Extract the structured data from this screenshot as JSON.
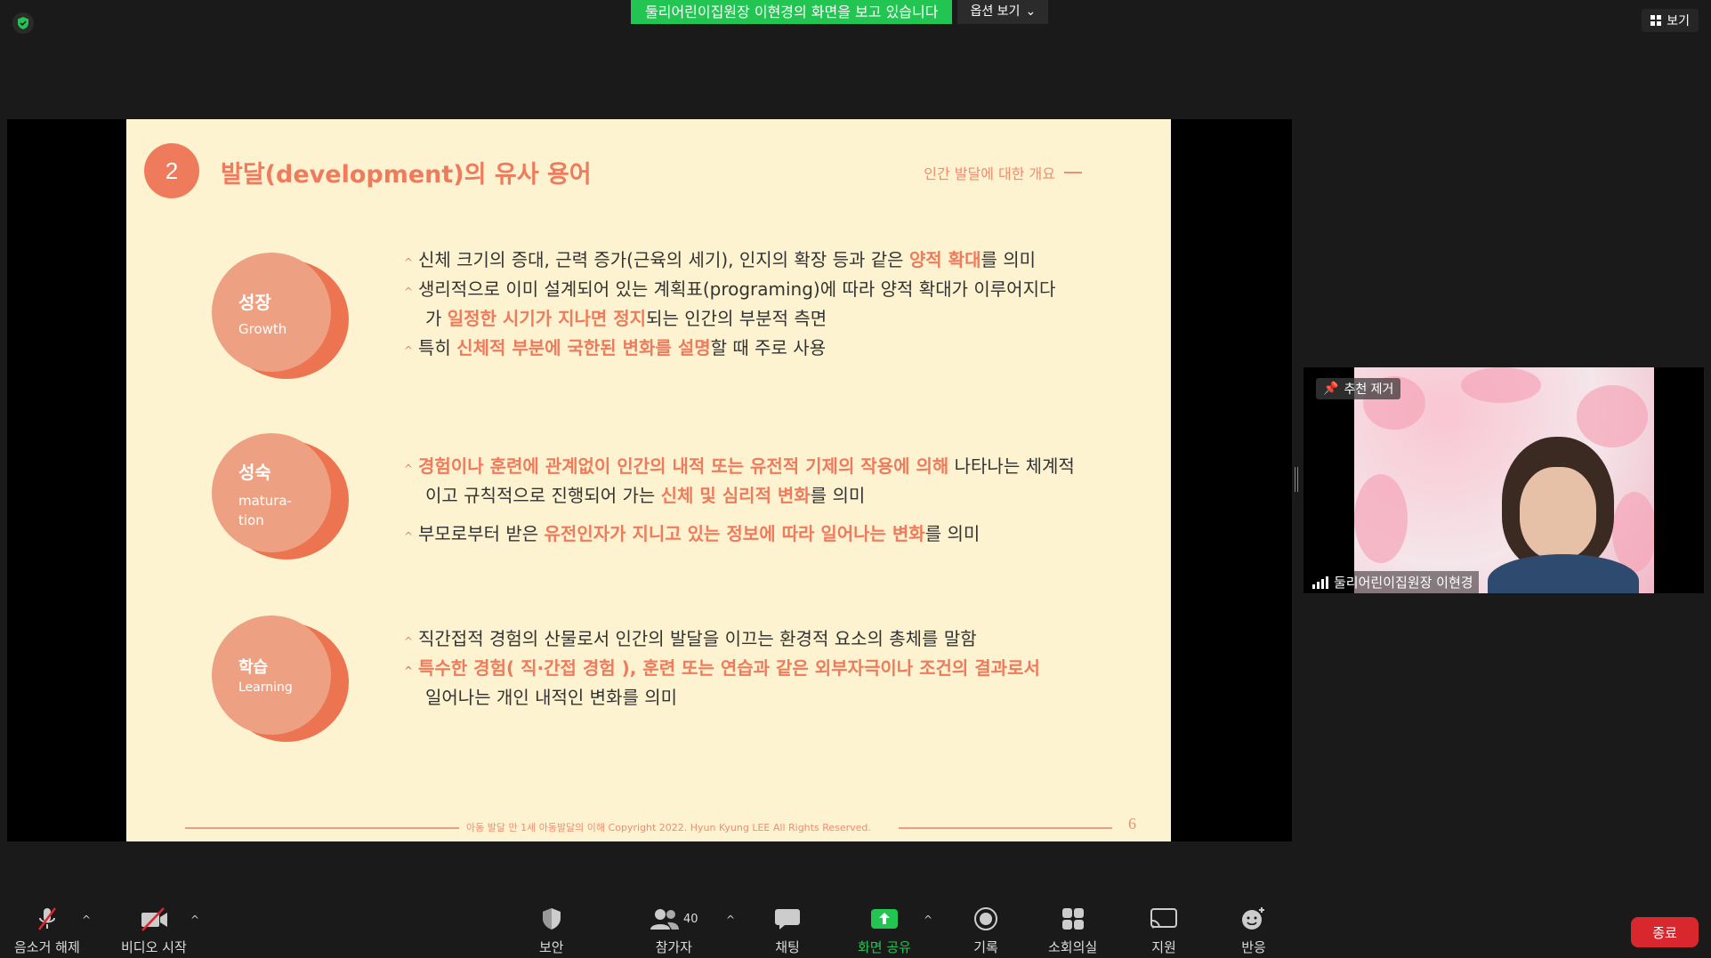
{
  "top": {
    "share_banner": "둘리어린이집원장 이현경의 화면을 보고 있습니다",
    "options_label": "옵션 보기",
    "view_label": "보기"
  },
  "slide": {
    "number": "2",
    "title": "발달(development)의 유사 용어",
    "subtitle": "인간 발달에 대한 개요",
    "terms": [
      {
        "ko": "성장",
        "en": "Growth"
      },
      {
        "ko": "성숙",
        "en1": "matura-",
        "en2": "tion"
      },
      {
        "ko": "학습",
        "en": "Learning"
      }
    ],
    "growth": {
      "l1a": "신체 크기의 증대, 근력 증가(근육의 세기), 인지의 확장 등과 같은 ",
      "l1b": "양적 확대",
      "l1c": "를 의미",
      "l2": "생리적으로 이미 설계되어 있는 계획표(programing)에 따라 양적 확대가 이루어지다",
      "l3a": "가 ",
      "l3b": "일정한 시기가 지나면 정지",
      "l3c": "되는 인간의 부분적 측면",
      "l4a": "특히 ",
      "l4b": "신체적 부분에 국한된 변화를 설명",
      "l4c": "할 때 주로 사용"
    },
    "maturation": {
      "l1a": "경험이나 훈련에 관계없이 인간의 내적 또는 유전적 기제의 작용에 의해",
      "l1b": " 나타나는 체계적",
      "l2a": "이고 규칙적으로 진행되어 가는 ",
      "l2b": "신체 및 심리적 변화",
      "l2c": "를 의미",
      "l3a": "부모로부터 받은 ",
      "l3b": "유전인자가 지니고 있는 정보에 따라 일어나는 변화",
      "l3c": "를 의미"
    },
    "learning": {
      "l1": "직간접적 경험의 산물로서 인간의 발달을 이끄는 환경적 요소의 총체를 말함",
      "l2": "특수한 경험( 직·간접 경험 ), 훈련 또는 연습과 같은 외부자극이나 조건의 결과로서",
      "l3": "일어나는 개인 내적인 변화를 의미"
    },
    "footer": "아동 발달 만 1세 아동발달의 이해 Copyright 2022. Hyun Kyung LEE All Rights Reserved.",
    "page": "6"
  },
  "video": {
    "pin_label": "추천 제거",
    "name": "둘리어린이집원장 이현경"
  },
  "toolbar": {
    "unmute": "음소거 해제",
    "video": "비디오 시작",
    "security": "보안",
    "participants": "참가자",
    "participant_count": "40",
    "chat": "채팅",
    "share": "화면 공유",
    "record": "기록",
    "breakout": "소회의실",
    "support": "지원",
    "reactions": "반응",
    "end": "종료"
  },
  "colors": {
    "accent": "#ee7b5c",
    "share_green": "#23c552",
    "end_red": "#d9272e",
    "slide_bg": "#fef3d1"
  }
}
